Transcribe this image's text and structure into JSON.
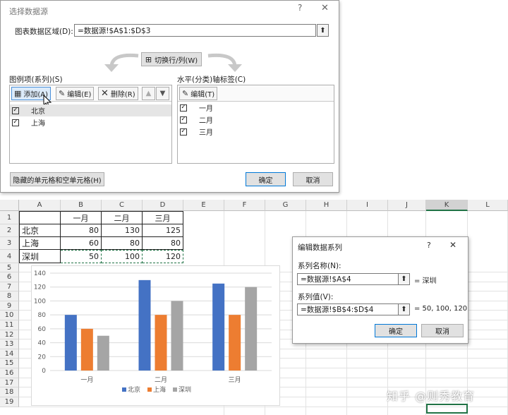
{
  "dialog_select": {
    "title": "选择数据源",
    "help": "?",
    "close": "✕",
    "range_label": "图表数据区域(D):",
    "range_value": "=数据源!$A$1:$D$3",
    "switch_button": "切换行/列(W)",
    "legend_label": "图例项(系列)(S)",
    "add_button": "添加(A)",
    "edit_button": "编辑(E)",
    "delete_button": "删除(R)",
    "series": [
      {
        "label": "北京",
        "checked": true
      },
      {
        "label": "上海",
        "checked": true
      }
    ],
    "axis_label": "水平(分类)轴标签(C)",
    "axis_edit_button": "编辑(T)",
    "categories": [
      {
        "label": "一月",
        "checked": true
      },
      {
        "label": "二月",
        "checked": true
      },
      {
        "label": "三月",
        "checked": true
      }
    ],
    "hidden_cells_button": "隐藏的单元格和空单元格(H)",
    "ok_button": "确定",
    "cancel_button": "取消"
  },
  "sheet": {
    "columns": [
      "A",
      "B",
      "C",
      "D",
      "E",
      "F",
      "G",
      "H",
      "I",
      "J",
      "K",
      "L"
    ],
    "rows": [
      "1",
      "2",
      "3",
      "4",
      "5",
      "6",
      "7",
      "8",
      "9",
      "10",
      "11",
      "12",
      "13",
      "14",
      "15",
      "16",
      "17",
      "18",
      "19"
    ],
    "header": [
      "",
      "一月",
      "二月",
      "三月"
    ],
    "data": [
      [
        "北京",
        "80",
        "130",
        "125"
      ],
      [
        "上海",
        "60",
        "80",
        "80"
      ],
      [
        "深圳",
        "50",
        "100",
        "120"
      ]
    ]
  },
  "chart_data": {
    "type": "bar",
    "categories": [
      "一月",
      "二月",
      "三月"
    ],
    "series": [
      {
        "name": "北京",
        "values": [
          80,
          130,
          125
        ],
        "color": "#4472c4"
      },
      {
        "name": "上海",
        "values": [
          60,
          80,
          80
        ],
        "color": "#ed7d31"
      },
      {
        "name": "深圳",
        "values": [
          50,
          100,
          120
        ],
        "color": "#a5a5a5"
      }
    ],
    "ylim": [
      0,
      140
    ],
    "yticks": [
      "0",
      "20",
      "40",
      "60",
      "80",
      "100",
      "120",
      "140"
    ],
    "grid": true,
    "legend": "bottom"
  },
  "dialog_edit": {
    "title": "编辑数据系列",
    "help": "?",
    "close": "✕",
    "name_label": "系列名称(N):",
    "name_value": "=数据源!$A$4",
    "name_result": "= 深圳",
    "values_label": "系列值(V):",
    "values_value": "=数据源!$B$4:$D$4",
    "values_result": "= 50, 100, 120",
    "ok_button": "确定",
    "cancel_button": "取消"
  },
  "watermark": "知乎 @则秀教育"
}
